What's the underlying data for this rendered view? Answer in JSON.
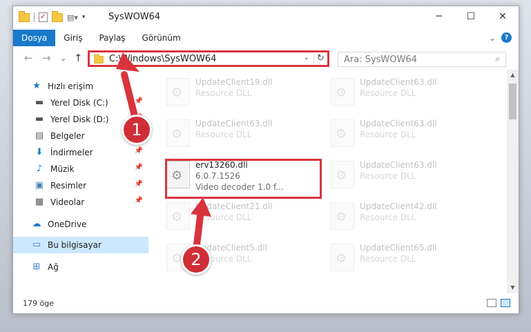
{
  "window": {
    "title": "SysWOW64",
    "controls": {
      "minimize": "─",
      "maximize": "☐",
      "close": "✕"
    }
  },
  "ribbon": {
    "tabs": [
      "Dosya",
      "Giriş",
      "Paylaş",
      "Görünüm"
    ],
    "expand": "⌄",
    "help": "?"
  },
  "navigation": {
    "back": "←",
    "forward": "→",
    "recent": "⌄",
    "up": "↑",
    "address_path": "C:\\Windows\\SysWOW64",
    "address_dropdown": "⌄",
    "refresh": "↻",
    "search_placeholder": "Ara: SysWOW64",
    "search_icon": "⌕"
  },
  "sidebar": {
    "quick_access": "Hızlı erişim",
    "pinned": [
      {
        "label": "Yerel Disk (C:)",
        "icon": "drive-icon"
      },
      {
        "label": "Yerel Disk (D:)",
        "icon": "drive-icon"
      },
      {
        "label": "Belgeler",
        "icon": "documents-icon"
      },
      {
        "label": "İndirmeler",
        "icon": "downloads-icon"
      },
      {
        "label": "Müzik",
        "icon": "music-icon"
      },
      {
        "label": "Resimler",
        "icon": "pictures-icon"
      },
      {
        "label": "Videolar",
        "icon": "videos-icon"
      }
    ],
    "onedrive": "OneDrive",
    "this_pc": "Bu bilgisayar",
    "network": "Ağ"
  },
  "files": {
    "left": [
      {
        "name": "UpdateClient19.dll",
        "sub": "Resource DLL"
      },
      {
        "name": "UpdateClient63.dll",
        "sub": "Resource DLL"
      },
      {
        "name": "erv13260.dll",
        "sub": "6.0.7.1526",
        "sub2": "Video decoder 1.0 f..."
      },
      {
        "name": "UpdateClient21.dll",
        "sub": "Resource DLL"
      },
      {
        "name": "UpdateClient5.dll",
        "sub": "Resource DLL"
      }
    ],
    "right": [
      {
        "name": "UpdateClient63.dll",
        "sub": "Resource DLL"
      },
      {
        "name": "UpdateClient63.dll",
        "sub": "Resource DLL"
      },
      {
        "name": "UpdateClient63.dll",
        "sub": "Resource DLL"
      },
      {
        "name": "UpdateClient42.dll",
        "sub": "Resource DLL"
      },
      {
        "name": "UpdateClient65.dll",
        "sub": "Resource DLL"
      }
    ]
  },
  "status": {
    "item_count": "179 öge"
  },
  "annotations": {
    "step1": "1",
    "step2": "2",
    "color": "#d9343d"
  }
}
